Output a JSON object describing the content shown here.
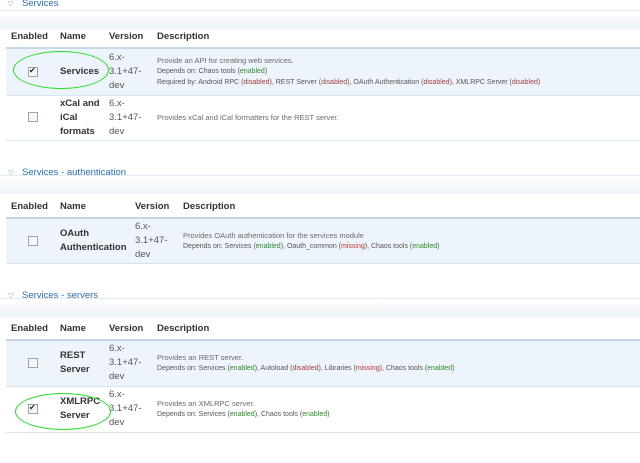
{
  "sections": [
    {
      "legend": "Services",
      "headers": {
        "enabled": "Enabled",
        "name": "Name",
        "version": "Version",
        "description": "Description"
      },
      "rows": [
        {
          "checked": true,
          "name": "Services",
          "version": "6.x-3.1+47-dev",
          "version_lines": [
            "6.x-",
            "3.1+47-",
            "dev"
          ],
          "description": "Provide an API for creating web services.",
          "depends_label": "Depends on:",
          "depends": [
            {
              "name": "Chaos tools",
              "status": "enabled"
            }
          ],
          "required_label": "Required by:",
          "required": [
            {
              "name": "Android RPC",
              "status": "disabled"
            },
            {
              "name": "REST Server",
              "status": "disabled"
            },
            {
              "name": "OAuth Authentication",
              "status": "disabled"
            },
            {
              "name": "XMLRPC Server",
              "status": "disabled"
            }
          ]
        },
        {
          "checked": false,
          "name": "xCal and iCal formats",
          "version": "6.x-3.1+47-dev",
          "name_lines": [
            "xCal and",
            "iCal",
            "formats"
          ],
          "version_lines": [
            "6.x-",
            "3.1+47-",
            "dev"
          ],
          "description": "Provides xCal and iCal formatters for the REST server."
        }
      ]
    },
    {
      "legend": "Services - authentication",
      "headers": {
        "enabled": "Enabled",
        "name": "Name",
        "version": "Version",
        "description": "Description"
      },
      "rows": [
        {
          "checked": false,
          "name": "OAuth Authentication",
          "version": "6.x-3.1+47-dev",
          "name_lines": [
            "OAuth",
            "Authentication"
          ],
          "version_lines": [
            "6.x-",
            "3.1+47-",
            "dev"
          ],
          "description": "Provides OAuth authentication for the services module",
          "depends_label": "Depends on:",
          "depends": [
            {
              "name": "Services",
              "status": "enabled"
            },
            {
              "name": "Oauth_common",
              "status": "missing"
            },
            {
              "name": "Chaos tools",
              "status": "enabled"
            }
          ]
        }
      ]
    },
    {
      "legend": "Services - servers",
      "headers": {
        "enabled": "Enabled",
        "name": "Name",
        "version": "Version",
        "description": "Description"
      },
      "rows": [
        {
          "checked": false,
          "name": "REST Server",
          "version": "6.x-3.1+47-dev",
          "name_lines": [
            "REST",
            "Server"
          ],
          "version_lines": [
            "6.x-",
            "3.1+47-",
            "dev"
          ],
          "description": "Provides an REST server.",
          "depends_label": "Depends on:",
          "depends": [
            {
              "name": "Services",
              "status": "enabled"
            },
            {
              "name": "Autoload",
              "status": "disabled"
            },
            {
              "name": "Libraries",
              "status": "missing"
            },
            {
              "name": "Chaos tools",
              "status": "enabled"
            }
          ]
        },
        {
          "checked": true,
          "name": "XMLRPC Server",
          "version": "6.x-3.1+47-dev",
          "name_lines": [
            "XMLRPC",
            "Server"
          ],
          "version_lines": [
            "6.x-",
            "3.1+47-",
            "dev"
          ],
          "description": "Provides an XMLRPC server.",
          "depends_label": "Depends on:",
          "depends": [
            {
              "name": "Services",
              "status": "enabled"
            },
            {
              "name": "Chaos tools",
              "status": "enabled"
            }
          ]
        }
      ]
    }
  ],
  "colors": {
    "legend": "#2a6fb0",
    "enabled": "#2e8b2e",
    "disabled": "#a04040",
    "missing": "#c0352f",
    "highlight_ring": "#22dd22"
  }
}
